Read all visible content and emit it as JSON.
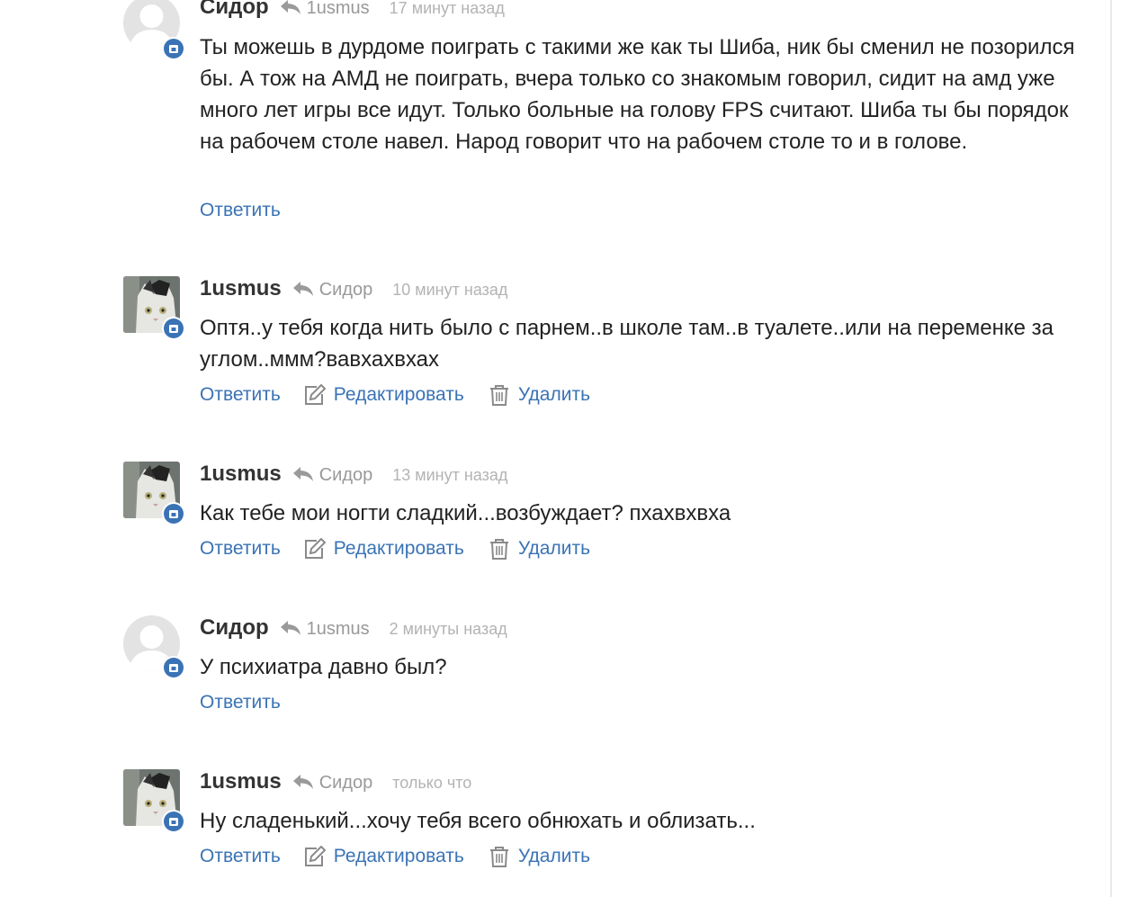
{
  "comments": [
    {
      "author": "Сидор",
      "reply_to": "1usmus",
      "time": "17 минут назад",
      "avatar": "default-avatar",
      "text": "Ты можешь в дурдоме поиграть с такими же как ты Шиба, ник бы сменил не позорился бы. А тож на АМД не поиграть, вчера только со знакомым говорил, сидит на амд уже много лет игры все идут. Только больные на голову FPS считают. Шиба ты бы порядок на рабочем столе навел. Народ говорит что на рабочем столе то и в голове.",
      "reply_label": "Ответить"
    },
    {
      "author": "1usmus",
      "reply_to": "Сидор",
      "time": "10 минут назад",
      "avatar": "cat-photo-avatar",
      "text": "Оптя..у тебя когда нить было с парнем..в школе там..в туалете..или на переменке за углом..ммм?вавхахвхах",
      "reply_label": "Ответить",
      "edit_label": "Редактировать",
      "delete_label": "Удалить"
    },
    {
      "author": "1usmus",
      "reply_to": "Сидор",
      "time": "13 минут назад",
      "avatar": "cat-photo-avatar",
      "text": "Как тебе мои ногти сладкий...возбуждает? пхахвхвха",
      "reply_label": "Ответить",
      "edit_label": "Редактировать",
      "delete_label": "Удалить"
    },
    {
      "author": "Сидор",
      "reply_to": "1usmus",
      "time": "2 минуты назад",
      "avatar": "default-avatar",
      "text": "У психиатра давно был?",
      "reply_label": "Ответить"
    },
    {
      "author": "1usmus",
      "reply_to": "Сидор",
      "time": "только что",
      "avatar": "cat-photo-avatar",
      "text": "Ну сладенький...хочу тебя всего обнюхать и облизать...",
      "reply_label": "Ответить",
      "edit_label": "Редактировать",
      "delete_label": "Удалить"
    }
  ],
  "colors": {
    "link": "#3a73b5",
    "badge": "#3a73b5",
    "muted": "#999999",
    "time": "#b3b3b3"
  },
  "icons": {
    "reply": "reply-arrow-icon",
    "edit": "pencil-edit-icon",
    "delete": "trash-icon",
    "badge": "camera-icon"
  }
}
